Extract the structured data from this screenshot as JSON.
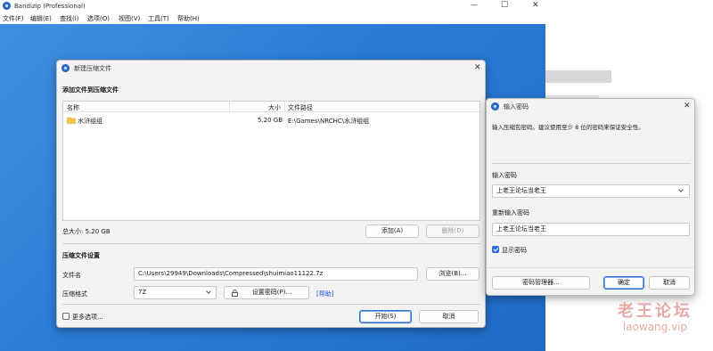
{
  "app": {
    "title": "Bandizip (Professional)",
    "window_controls": {
      "minimize": "—",
      "maximize": "☐",
      "close": "✕"
    }
  },
  "menu": [
    "文件(F)",
    "编辑(E)",
    "查找(I)",
    "选项(O)",
    "视图(V)",
    "工具(T)",
    "帮助(H)"
  ],
  "new_archive_dialog": {
    "title": "新建压缩文件",
    "close": "✕",
    "add_files_heading": "添加文件到压缩文件",
    "columns": {
      "name": "名称",
      "size": "大小",
      "path": "文件路径"
    },
    "rows": [
      {
        "name": "水浒组组",
        "size": "5.20 GB",
        "path": "E:\\Games\\NRCHC\\水浒组组",
        "icon": "folder-icon"
      }
    ],
    "total_size": "总大小: 5.20 GB",
    "add_button": "添加(A)",
    "delete_button": "删除(D)",
    "settings_heading": "压缩文件设置",
    "filename_label": "文件名",
    "filename_value": "C:\\Users\\29949\\Downloads\\Compressed\\shuimiao11122.7z",
    "browse_button": "浏览(B)...",
    "format_label": "压缩格式",
    "format_value": "7Z",
    "set_password_button": "设置密码(P)...",
    "help_link": "[帮助]",
    "more_options": "更多选项...",
    "start_button": "开始(S)",
    "cancel_button": "取消"
  },
  "password_dialog": {
    "title": "输入密码",
    "close": "✕",
    "hint": "输入压缩包密码。建议使用至少 8 位的密码来保证安全性。",
    "password_label": "输入密码",
    "password_value": "上老王论坛当老王",
    "reenter_label": "重新输入密码",
    "reenter_value": "上老王论坛当老王",
    "show_password": "显示密码",
    "show_password_checked": true,
    "manager_button": "密码管理器...",
    "ok_button": "确定",
    "cancel_button": "取消"
  },
  "watermark": {
    "line1": "老王论坛",
    "line2": "laowang.vip"
  },
  "colors": {
    "accent": "#2f6fd1",
    "desktop": "#2a7bd6",
    "watermark": "#e8a8a8",
    "link": "#1a4fd6"
  }
}
